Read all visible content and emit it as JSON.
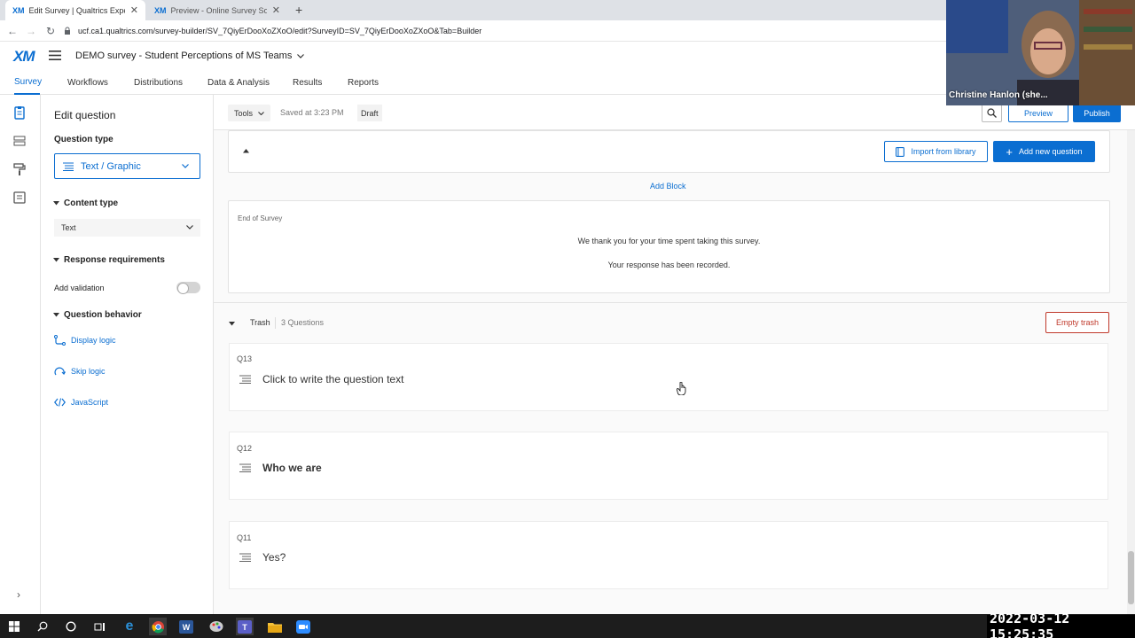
{
  "browser": {
    "tabs": [
      {
        "logo": "XM",
        "title": "Edit Survey | Qualtrics Experience"
      },
      {
        "logo": "XM",
        "title": "Preview - Online Survey Software"
      }
    ],
    "url": "ucf.ca1.qualtrics.com/survey-builder/SV_7QiyErDooXoZXoO/edit?SurveyID=SV_7QiyErDooXoZXoO&Tab=Builder"
  },
  "header": {
    "logo": "XM",
    "survey_title": "DEMO survey - Student Perceptions of MS Teams"
  },
  "nav": {
    "items": [
      "Survey",
      "Workflows",
      "Distributions",
      "Data & Analysis",
      "Results",
      "Reports"
    ]
  },
  "panel": {
    "title": "Edit question",
    "question_type_label": "Question type",
    "question_type_value": "Text / Graphic",
    "content_type_label": "Content type",
    "content_type_value": "Text",
    "response_req_label": "Response requirements",
    "add_validation_label": "Add validation",
    "question_behavior_label": "Question behavior",
    "display_logic": "Display logic",
    "skip_logic": "Skip logic",
    "javascript": "JavaScript"
  },
  "toolbar": {
    "tools": "Tools",
    "saved": "Saved at 3:23 PM",
    "draft": "Draft",
    "preview": "Preview",
    "publish": "Publish"
  },
  "block": {
    "import_library": "Import from library",
    "add_new_question": "Add new question",
    "add_block": "Add Block"
  },
  "end_of_survey": {
    "label": "End of Survey",
    "line1": "We thank you for your time spent taking this survey.",
    "line2": "Your response has been recorded."
  },
  "trash": {
    "label": "Trash",
    "count": "3 Questions",
    "empty_button": "Empty trash",
    "questions": [
      {
        "id": "Q13",
        "text": "Click to write the question text",
        "bold": false
      },
      {
        "id": "Q12",
        "text": "Who we are",
        "bold": true
      },
      {
        "id": "Q11",
        "text": "Yes?",
        "bold": false
      }
    ]
  },
  "video": {
    "name": "Christine Hanlon (she..."
  },
  "taskbar": {
    "clock": "2022-03-12  15:25:35"
  },
  "colors": {
    "accent": "#0b6ed1",
    "danger": "#c0392b"
  }
}
